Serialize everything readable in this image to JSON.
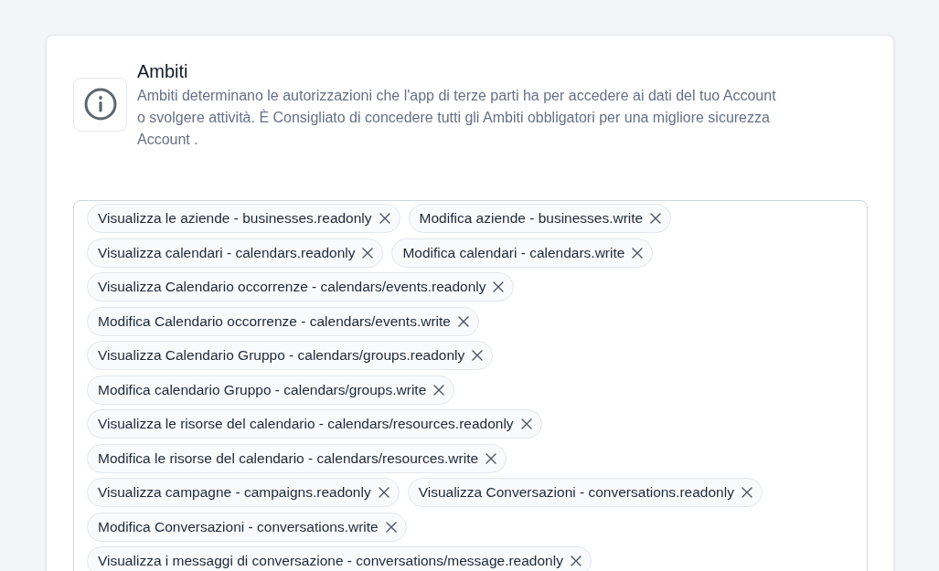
{
  "section": {
    "title": "Ambiti",
    "description": "Ambiti determinano le autorizzazioni che l'app di terze parti ha per accedere ai dati del tuo Account o svolgere attività. È Consigliato di concedere tutti gli Ambiti obbligatori per una migliore sicurezza Account ."
  },
  "scopes": [
    {
      "label": "Visualizza le aziende - businesses.readonly"
    },
    {
      "label": "Modifica aziende - businesses.write"
    },
    {
      "label": "Visualizza calendari - calendars.readonly"
    },
    {
      "label": "Modifica calendari - calendars.write"
    },
    {
      "label": "Visualizza Calendario occorrenze - calendars/events.readonly"
    },
    {
      "label": "Modifica Calendario occorrenze - calendars/events.write"
    },
    {
      "label": "Visualizza Calendario Gruppo - calendars/groups.readonly"
    },
    {
      "label": "Modifica calendario Gruppo - calendars/groups.write"
    },
    {
      "label": "Visualizza le risorse del calendario - calendars/resources.readonly"
    },
    {
      "label": "Modifica le risorse del calendario - calendars/resources.write"
    },
    {
      "label": "Visualizza campagne - campaigns.readonly"
    },
    {
      "label": "Visualizza Conversazioni - conversations.readonly"
    },
    {
      "label": "Modifica Conversazioni - conversations.write"
    },
    {
      "label": "Visualizza i messaggi di conversazione - conversations/message.readonly"
    }
  ]
}
